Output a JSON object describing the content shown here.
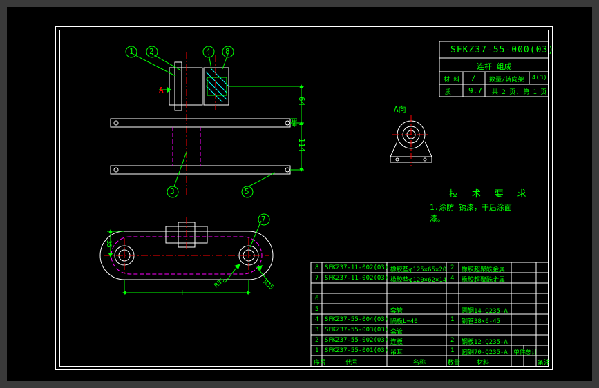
{
  "title_block": {
    "drawing_no": "SFKZ37-55-000(03)",
    "title": "连杆 组成",
    "material_label": "材 料",
    "material_value": "/",
    "qty_label": "数量/转向架",
    "qty_value": "4(3)",
    "mass_label": "质",
    "mass_value": "9.7",
    "page_info": "共 2 页, 第 1 页"
  },
  "tech_req": {
    "heading": "技 术 要 求",
    "line1": "1.涂防 锈漆，干后涂面",
    "line2": "漆。"
  },
  "views": {
    "section_label": "A",
    "view_a_label": "A向"
  },
  "balloons": {
    "b1": "1",
    "b2": "2",
    "b3": "3",
    "b4": "4",
    "b5": "5",
    "b7": "7",
    "b8": "8"
  },
  "dims": {
    "d114": "114",
    "d64": "64",
    "d14": "14",
    "d35": "35",
    "r35a": "R35",
    "r35b": "R35",
    "L": "L"
  },
  "bom": {
    "headers": {
      "no": "序号",
      "code": "代号",
      "name": "名称",
      "qty": "数量",
      "mat": "材料",
      "unit": "单件",
      "total": "总计",
      "note": "备注"
    },
    "rows": [
      {
        "no": "1",
        "code": "SFKZ37-55-001(03)",
        "name": "吊耳",
        "qty": "1",
        "mat": "圆钢70-Q235-A"
      },
      {
        "no": "2",
        "code": "SFKZ37-55-002(03)",
        "name": "连板",
        "qty": "2",
        "mat": "钢板12-Q235-A"
      },
      {
        "no": "3",
        "code": "SFKZ37-55-003(03)",
        "name": "套管",
        "qty": "",
        "mat": ""
      },
      {
        "no": "4",
        "code": "SFKZ37-55-004(03)",
        "name": "隔板L=40",
        "qty": "1",
        "mat": "钢管38×6-45"
      },
      {
        "no": "5",
        "code": "",
        "name": "套管",
        "qty": "",
        "mat": "圆钢14-Q235-A"
      },
      {
        "no": "6",
        "code": "",
        "name": "",
        "qty": "",
        "mat": ""
      },
      {
        "no": "7",
        "code": "SFKZ37-11-002(03)",
        "name": "橡胶垫φ120×62×14",
        "qty": "4",
        "mat": "橡胶超聚酰金属"
      },
      {
        "no": "8",
        "code": "SFKZ37-11-002(03)",
        "name": "橡胶垫φ125×65×20",
        "qty": "2",
        "mat": "橡胶超聚酰金属"
      }
    ]
  }
}
